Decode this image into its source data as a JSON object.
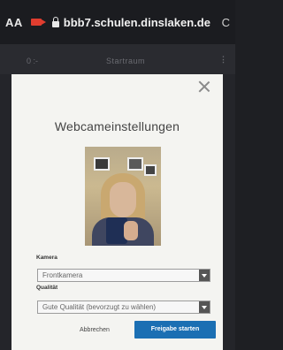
{
  "browser": {
    "text_size_label": "AA",
    "url": "bbb7.schulen.dinslaken.de",
    "reload_glyph": "C"
  },
  "page": {
    "left": "0 :-",
    "center": "Startraum",
    "right": "⋮"
  },
  "modal": {
    "title": "Webcameinstellungen",
    "camera_label": "Kamera",
    "camera_value": "Frontkamera",
    "quality_label": "Qualität",
    "quality_value": "Gute Qualität (bevorzugt zu wählen)",
    "cancel_label": "Abbrechen",
    "start_label": "Freigabe starten"
  },
  "colors": {
    "accent": "#1b6fb3",
    "recording": "#e03d2f"
  }
}
